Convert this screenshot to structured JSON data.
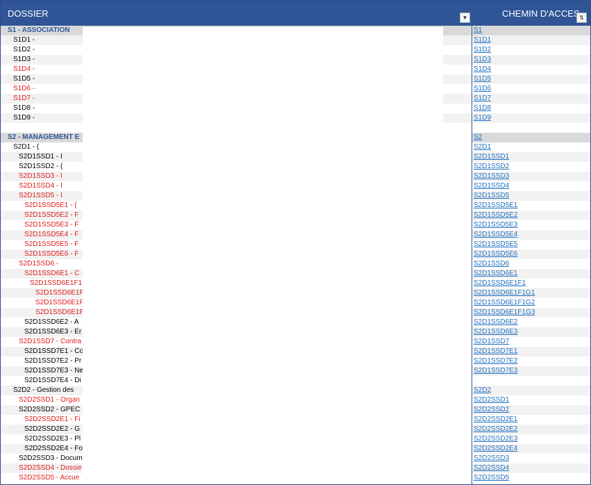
{
  "header": {
    "left_title": "DOSSIER",
    "right_title": "CHEMIN D'ACCES",
    "filter_icon": "dropdown-arrow-icon",
    "sort_icon": "sort-icon"
  },
  "rows": [
    {
      "t": "S1 - ASSOCIATION",
      "lvl": 0,
      "red": false,
      "sec": true,
      "link": "S1"
    },
    {
      "t": "S1D1 -",
      "lvl": 1,
      "red": false,
      "link": "S1D1"
    },
    {
      "t": "S1D2 -",
      "lvl": 1,
      "red": false,
      "link": "S1D2"
    },
    {
      "t": "S1D3 -",
      "lvl": 1,
      "red": false,
      "link": "S1D3"
    },
    {
      "t": "S1D4 -",
      "lvl": 1,
      "red": true,
      "link": "S1D4"
    },
    {
      "t": "S1D5 -",
      "lvl": 1,
      "red": false,
      "link": "S1D5"
    },
    {
      "t": "S1D6 -",
      "lvl": 1,
      "red": true,
      "link": "S1D6"
    },
    {
      "t": "S1D7 -",
      "lvl": 1,
      "red": true,
      "link": "S1D7"
    },
    {
      "t": "S1D8 -",
      "lvl": 1,
      "red": false,
      "link": "S1D8"
    },
    {
      "t": "S1D9 -",
      "lvl": 1,
      "red": false,
      "link": "S1D9"
    },
    {
      "t": "",
      "lvl": 0,
      "red": false,
      "link": ""
    },
    {
      "t": "S2 - MANAGEMENT E",
      "lvl": 0,
      "red": false,
      "sec": true,
      "link": "S2"
    },
    {
      "t": "S2D1 - (",
      "lvl": 1,
      "red": false,
      "link": "S2D1"
    },
    {
      "t": "S2D1SSD1 - I",
      "lvl": 2,
      "red": false,
      "link": "S2D1SSD1"
    },
    {
      "t": "S2D1SSD2 - (",
      "lvl": 2,
      "red": false,
      "link": "S2D1SSD2"
    },
    {
      "t": "S2D1SSD3 - I",
      "lvl": 2,
      "red": true,
      "link": "S2D1SSD3"
    },
    {
      "t": "S2D1SSD4 - I",
      "lvl": 2,
      "red": true,
      "link": "S2D1SSD4"
    },
    {
      "t": "S2D1SSD5 - I",
      "lvl": 2,
      "red": true,
      "link": "S2D1SSD5"
    },
    {
      "t": "S2D1SSD5E1 - (",
      "lvl": 3,
      "red": true,
      "link": "S2D1SSD5E1"
    },
    {
      "t": "S2D1SSD5E2 - F",
      "lvl": 3,
      "red": true,
      "link": "S2D1SSD5E2"
    },
    {
      "t": "S2D1SSD5E3 - F",
      "lvl": 3,
      "red": true,
      "link": "S2D1SSD5E3"
    },
    {
      "t": "S2D1SSD5E4 - F",
      "lvl": 3,
      "red": true,
      "link": "S2D1SSD5E4"
    },
    {
      "t": "S2D1SSD5E5 - F",
      "lvl": 3,
      "red": true,
      "link": "S2D1SSD5E5"
    },
    {
      "t": "S2D1SSD5E6 - F",
      "lvl": 3,
      "red": true,
      "link": "S2D1SSD5E6"
    },
    {
      "t": "S2D1SSD6 -",
      "lvl": 2,
      "red": true,
      "link": "S2D1SSD6"
    },
    {
      "t": "S2D1SSD6E1 - C",
      "lvl": 3,
      "red": true,
      "link": "S2D1SSD6E1"
    },
    {
      "t": "S2D1SSD6E1F1",
      "lvl": 4,
      "red": true,
      "link": "S2D1SSD6E1F1"
    },
    {
      "t": "S2D1SSD6E1F",
      "lvl": 5,
      "red": true,
      "link": "S2D1SSD6E1F1G1"
    },
    {
      "t": "S2D1SSD6E1F",
      "lvl": 5,
      "red": true,
      "link": "S2D1SSD6E1F1G2"
    },
    {
      "t": "S2D1SSD6E1F",
      "lvl": 5,
      "red": true,
      "link": "S2D1SSD6E1F1G3"
    },
    {
      "t": "S2D1SSD6E2 - A",
      "lvl": 3,
      "red": false,
      "link": "S2D1SSD6E2"
    },
    {
      "t": "S2D1SSD6E3 - Er",
      "lvl": 3,
      "red": false,
      "link": "S2D1SSD6E3"
    },
    {
      "t": "S2D1SSD7 - Contra",
      "lvl": 2,
      "red": true,
      "link": "S2D1SSD7"
    },
    {
      "t": "S2D1SSD7E1 - Co",
      "lvl": 3,
      "red": false,
      "link": "S2D1SSD7E1"
    },
    {
      "t": "S2D1SSD7E2 - Pr",
      "lvl": 3,
      "red": false,
      "link": "S2D1SSD7E2"
    },
    {
      "t": "S2D1SSD7E3 - Ne",
      "lvl": 3,
      "red": false,
      "link": "S2D1SSD7E3"
    },
    {
      "t": "S2D1SSD7E4 - Di",
      "lvl": 3,
      "red": false,
      "link": ""
    },
    {
      "t": "S2D2 - Gestion des",
      "lvl": 1,
      "red": false,
      "link": "S2D2"
    },
    {
      "t": "S2D2SSD1 - Organ",
      "lvl": 2,
      "red": true,
      "link": "S2D2SSD1"
    },
    {
      "t": "S2D2SSD2 - GPEC",
      "lvl": 2,
      "red": false,
      "link": "S2D2SSD2"
    },
    {
      "t": "S2D2SSD2E1 - Fi",
      "lvl": 3,
      "red": true,
      "link": "S2D2SSD2E1"
    },
    {
      "t": "S2D2SSD2E2 - G",
      "lvl": 3,
      "red": false,
      "link": "S2D2SSD2E2"
    },
    {
      "t": "S2D2SSD2E3 - Pl",
      "lvl": 3,
      "red": false,
      "link": "S2D2SSD2E3"
    },
    {
      "t": "S2D2SSD2E4 - Fo",
      "lvl": 3,
      "red": false,
      "link": "S2D2SSD2E4"
    },
    {
      "t": "S2D2SSD3 - Docum",
      "lvl": 2,
      "red": false,
      "link": "S2D2SSD3"
    },
    {
      "t": "S2D2SSD4 - Dossie",
      "lvl": 2,
      "red": true,
      "link": "S2D2SSD4"
    },
    {
      "t": "S2D2SSD5 - Accue",
      "lvl": 2,
      "red": true,
      "link": "S2D2SSD5"
    }
  ]
}
